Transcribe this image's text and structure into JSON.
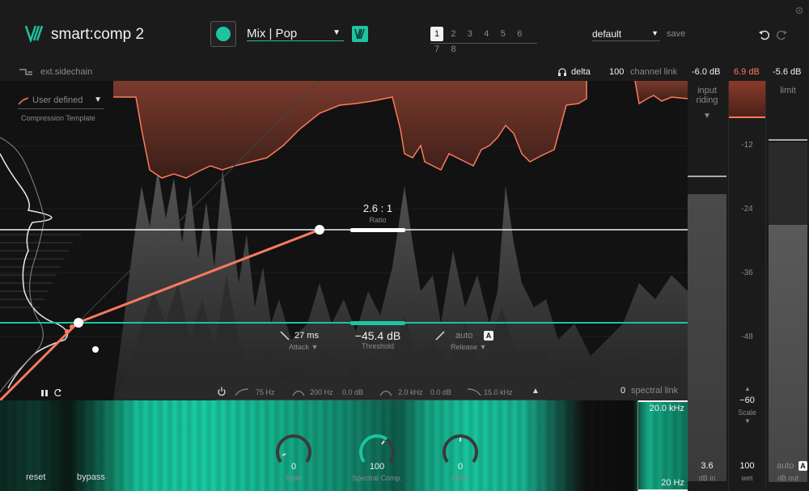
{
  "header": {
    "app_title": "smart:comp 2",
    "profile": "Mix | Pop",
    "preset_slots": [
      "1",
      "2",
      "3",
      "4",
      "5",
      "6",
      "7",
      "8"
    ],
    "active_slot": "1",
    "preset_name": "default",
    "save_label": "save"
  },
  "subheader": {
    "sidechain_label": "ext.sidechain",
    "delta_label": "delta",
    "channel_link_value": "100",
    "channel_link_label": "channel link",
    "meter_in_value": "-6.0 dB",
    "meter_gain_value": "6.9 dB",
    "meter_out_value": "-5.6 dB"
  },
  "template": {
    "selected": "User defined",
    "caption": "Compression Template"
  },
  "controls": {
    "ratio_value": "2.6 : 1",
    "ratio_label": "Ratio",
    "attack_value": "27 ms",
    "attack_label": "Attack",
    "threshold_value": "−45.4 dB",
    "threshold_label": "Threshold",
    "release_value": "auto",
    "release_badge": "A",
    "release_label": "Release"
  },
  "eq": {
    "band1": "75 Hz",
    "band2_freq": "200 Hz",
    "band2_gain": "0.0 dB",
    "band3_freq": "2.0 kHz",
    "band3_gain": "0.0 dB",
    "band4": "15.0 kHz",
    "spectral_link_value": "0",
    "spectral_link_label": "spectral link"
  },
  "spectral": {
    "freq_top": "20.0 kHz",
    "freq_bottom": "20 Hz",
    "reset_label": "reset",
    "bypass_label": "bypass",
    "style_value": "0",
    "style_label": "Style",
    "spectral_comp_value": "100",
    "spectral_comp_label": "Spectral Comp.",
    "color_value": "0",
    "color_label": "Color"
  },
  "meters": {
    "input_riding_label_1": "input",
    "input_riding_label_2": "riding",
    "limit_label": "limit",
    "scale_ticks": [
      "-12",
      "-24",
      "-36",
      "-48"
    ],
    "scale_min": "−60",
    "scale_label": "Scale",
    "db_in_value": "3.6",
    "db_in_label": "dB in",
    "wet_value": "100",
    "wet_label": "wet",
    "out_value": "auto",
    "out_badge": "A",
    "out_label": "dB out"
  },
  "colors": {
    "accent_teal": "#1ec3a0",
    "accent_orange": "#ff7a5c",
    "background": "#121212"
  }
}
